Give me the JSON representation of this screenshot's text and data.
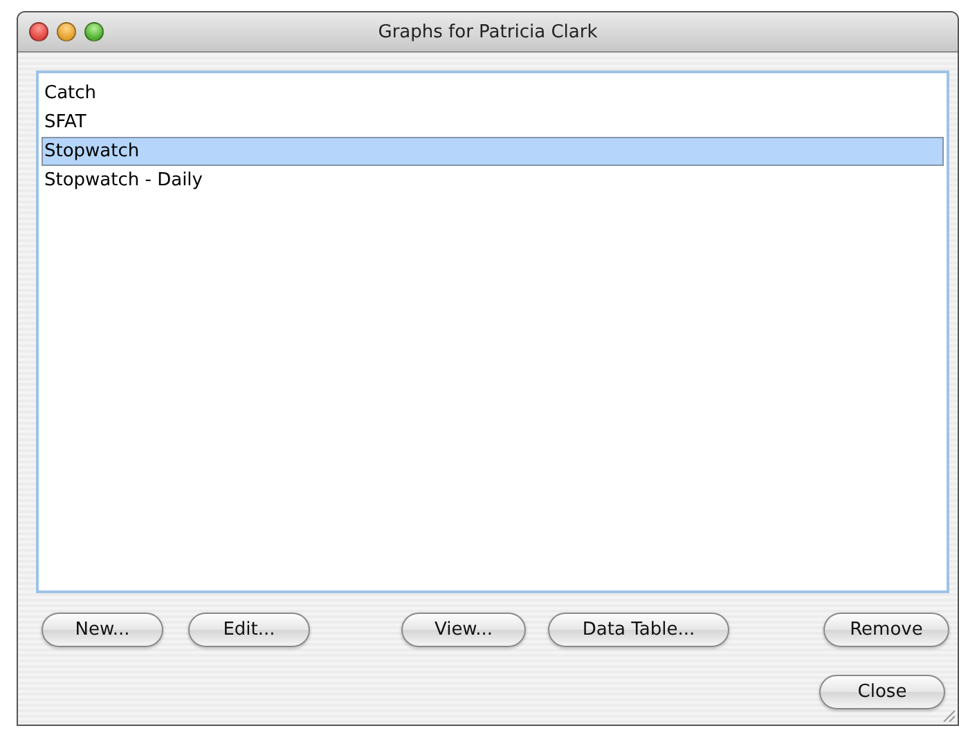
{
  "window": {
    "title": "Graphs for Patricia Clark"
  },
  "list": {
    "items": [
      {
        "label": "Catch",
        "selected": false
      },
      {
        "label": "SFAT",
        "selected": false
      },
      {
        "label": "Stopwatch",
        "selected": true
      },
      {
        "label": "Stopwatch - Daily",
        "selected": false
      }
    ]
  },
  "buttons": [
    {
      "label": "New...",
      "kind": "left"
    },
    {
      "label": "Edit...",
      "kind": "left"
    },
    {
      "label": "View...",
      "kind": "middle"
    },
    {
      "label": "Data Table...",
      "kind": "middle"
    },
    {
      "label": "Remove",
      "kind": "right"
    },
    {
      "label": "Close",
      "kind": "bottom"
    }
  ]
}
